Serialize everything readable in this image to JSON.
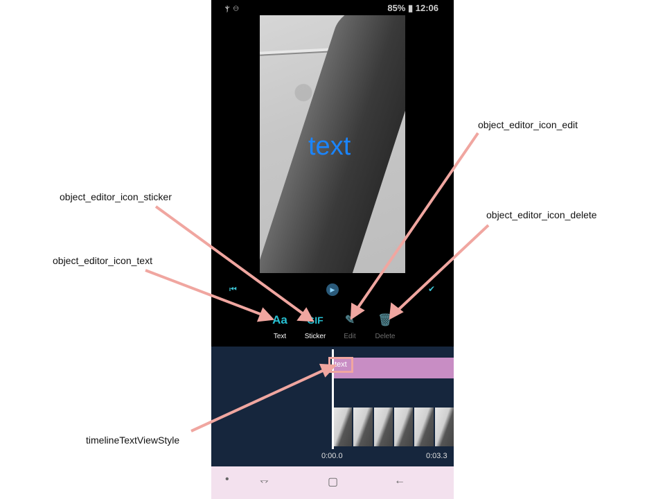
{
  "status_bar": {
    "left_icons": "ⲯ ⊖",
    "right": "85% ▮ 12:06"
  },
  "video": {
    "overlay_text": "text"
  },
  "toolbar": {
    "items": [
      {
        "icon": "Aa",
        "label": "Text",
        "enabled": true
      },
      {
        "icon": "GIF",
        "label": "Sticker",
        "enabled": true
      },
      {
        "icon": "✎",
        "label": "Edit",
        "enabled": false
      },
      {
        "icon": "🗑",
        "label": "Delete",
        "enabled": false
      }
    ]
  },
  "timeline": {
    "text_track_label": "text",
    "start_time": "0:00.0",
    "end_time": "0:03.3"
  },
  "callouts": {
    "sticker": "object_editor_icon_sticker",
    "text": "object_editor_icon_text",
    "edit": "object_editor_icon_edit",
    "delete": "object_editor_icon_delete",
    "timeline_text": "timelineTextViewStyle"
  },
  "colors": {
    "accent": "#27c0d2",
    "annotation": "#f0a6a0",
    "overlay_text": "#1a85ff",
    "track": "#c88dc4"
  }
}
